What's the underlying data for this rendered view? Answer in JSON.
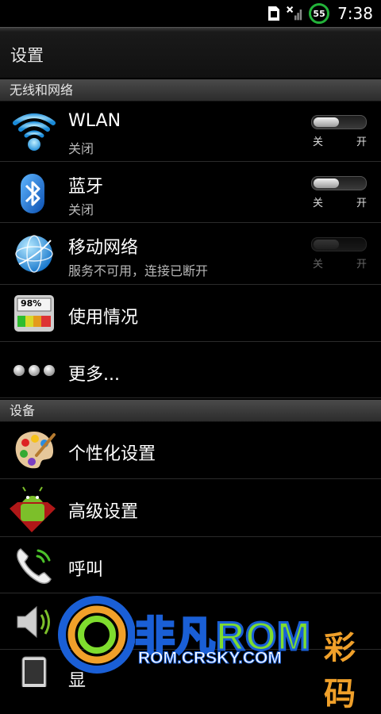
{
  "status_bar": {
    "battery_level": "55",
    "time": "7:38",
    "icons": [
      "sd-card-icon",
      "no-signal-icon",
      "battery-icon"
    ]
  },
  "title": "设置",
  "sections": {
    "wireless": "无线和网络",
    "device": "设备"
  },
  "items": {
    "wlan": {
      "label": "WLAN",
      "sub": "关闭",
      "off": "关",
      "on": "开",
      "icon": "wifi-icon"
    },
    "bluetooth": {
      "label": "蓝牙",
      "sub": "关闭",
      "off": "关",
      "on": "开",
      "icon": "bluetooth-icon"
    },
    "mobile": {
      "label": "移动网络",
      "sub": "服务不可用，连接已断开",
      "off": "关",
      "on": "开",
      "icon": "globe-icon"
    },
    "usage": {
      "label": "使用情况",
      "badge": "98%",
      "icon": "data-usage-icon"
    },
    "more": {
      "label": "更多...",
      "icon": "more-dots-icon"
    },
    "personalize": {
      "label": "个性化设置",
      "icon": "palette-icon"
    },
    "advanced": {
      "label": "高级设置",
      "icon": "android-icon"
    },
    "call": {
      "label": "呼叫",
      "icon": "phone-icon"
    },
    "sound": {
      "icon": "speaker-icon"
    },
    "display": {
      "label": "显",
      "icon": "display-icon"
    }
  },
  "watermark": {
    "brand_main": "非凡",
    "brand_rom": "ROM",
    "url": "ROM.CRSKY.COM",
    "right_fragment": "彩码"
  },
  "colors": {
    "accent_blue": "#1a5fd6",
    "battery_green": "#23b33a",
    "background": "#000000"
  }
}
